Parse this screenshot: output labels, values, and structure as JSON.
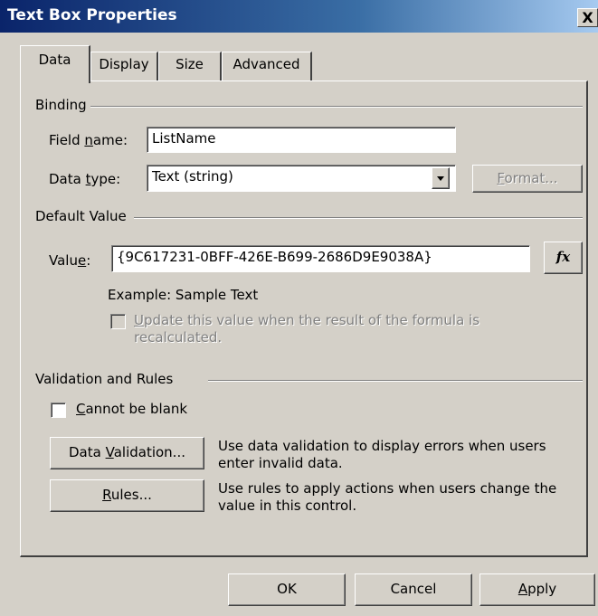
{
  "window": {
    "title": "Text Box Properties",
    "close_glyph": "X"
  },
  "tabs": [
    {
      "label": "Data",
      "active": true
    },
    {
      "label": "Display",
      "active": false
    },
    {
      "label": "Size",
      "active": false
    },
    {
      "label": "Advanced",
      "active": false
    }
  ],
  "binding": {
    "group_label": "Binding",
    "field_name_label_pre": "Field ",
    "field_name_label_accel": "n",
    "field_name_label_post": "ame:",
    "field_name_value": "ListName",
    "data_type_label_pre": "Data ",
    "data_type_label_accel": "t",
    "data_type_label_post": "ype:",
    "data_type_value": "Text (string)",
    "format_button_accel": "F",
    "format_button_rest": "ormat..."
  },
  "default_value": {
    "group_label": "Default Value",
    "value_label_pre": "Valu",
    "value_label_accel": "e",
    "value_label_post": ":",
    "value": "{9C617231-0BFF-426E-B699-2686D9E9038A}",
    "fx_label": "fx",
    "example_text": "Example: Sample Text",
    "update_checkbox_accel": "U",
    "update_checkbox_line1_rest": "pdate this value when the result of the formula is",
    "update_checkbox_line2": "recalculated."
  },
  "validation": {
    "group_label": "Validation and Rules",
    "cannot_blank_accel": "C",
    "cannot_blank_rest": "annot be blank",
    "data_validation_pre": "Data ",
    "data_validation_accel": "V",
    "data_validation_post": "alidation...",
    "data_validation_desc": "Use data validation to display errors when users enter invalid data.",
    "rules_accel": "R",
    "rules_rest": "ules...",
    "rules_desc": "Use rules to apply actions when users change the value in this control."
  },
  "footer": {
    "ok_label": "OK",
    "cancel_label": "Cancel",
    "apply_accel": "A",
    "apply_rest": "pply"
  }
}
